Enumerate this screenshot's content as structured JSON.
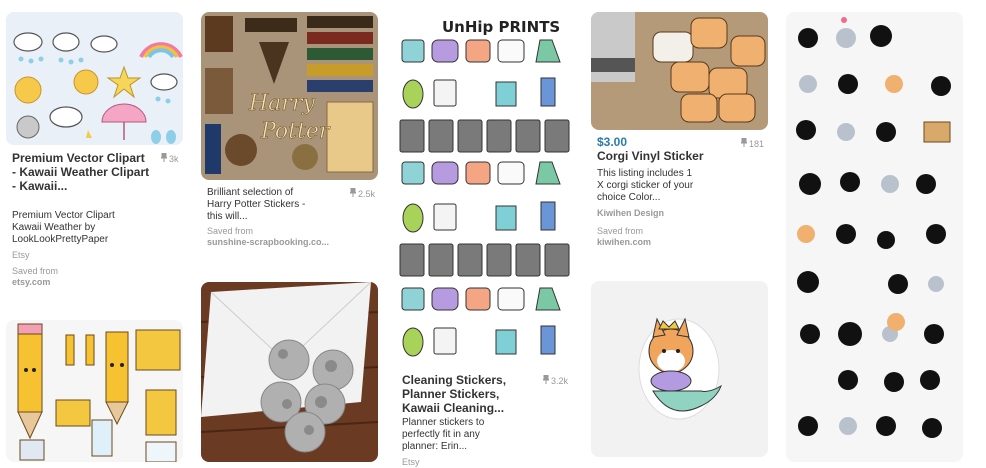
{
  "colors": {
    "price": "#2a7ab0",
    "muted": "#999999"
  },
  "pins": [
    {
      "title": "Premium Vector Clipart - Kawaii Weather Clipart - Kawaii...",
      "saves": "3k",
      "description": "Premium Vector Clipart Kawaii Weather by LookLookPrettyPaper",
      "source": "Etsy",
      "saved_from_label": "Saved from",
      "saved_from": "etsy.com"
    },
    {
      "title": "",
      "saves": "2.5k",
      "description": "Brilliant selection of Harry Potter Stickers - this will...",
      "saved_from_label": "Saved from",
      "saved_from": "sunshine-scrapbooking.co..."
    },
    {
      "header_text": "UnHip PRINTS",
      "title": "Cleaning Stickers, Planner Stickers, Kawaii Cleaning...",
      "saves": "3.2k",
      "description": "Planner stickers to perfectly fit in any planner: Erin...",
      "source": "Etsy"
    },
    {
      "price": "$3.00",
      "title": "Corgi Vinyl Sticker",
      "saves": "181",
      "description": "This listing includes 1 X corgi sticker of your choice Color...",
      "source": "Kiwihen Design",
      "saved_from_label": "Saved from",
      "saved_from": "kiwihen.com"
    }
  ],
  "harry_potter_title": "Harry Potter",
  "icons": [
    "pin-icon",
    "sticker-image"
  ]
}
